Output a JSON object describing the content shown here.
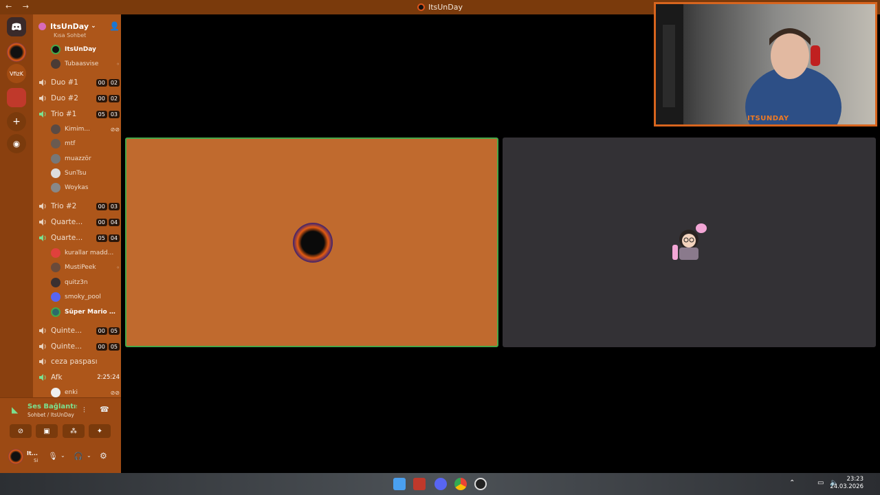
{
  "window": {
    "title": "ItsUnDay"
  },
  "servers": {
    "vfizk_label": "VfizK"
  },
  "guild": {
    "name": "ItsUnDay"
  },
  "category": {
    "label": "Kısa Sohbet"
  },
  "channels": [
    {
      "name": "Duo #1",
      "counts": [
        "00",
        "02"
      ]
    },
    {
      "name": "Duo #2",
      "counts": [
        "00",
        "02"
      ]
    },
    {
      "name": "Trio #1",
      "counts": [
        "05",
        "03"
      ]
    },
    {
      "name": "Trio #2",
      "counts": [
        "00",
        "03"
      ]
    },
    {
      "name": "Quarte...",
      "counts": [
        "00",
        "04"
      ]
    },
    {
      "name": "Quarte...",
      "counts": [
        "05",
        "04"
      ]
    },
    {
      "name": "Quinte...",
      "counts": [
        "00",
        "05"
      ]
    },
    {
      "name": "Quinte...",
      "counts": [
        "00",
        "05"
      ]
    },
    {
      "name": "ceza paspası"
    },
    {
      "name": "Afk",
      "timer": "2:25:24"
    }
  ],
  "users": {
    "top": [
      "ItsUnDay",
      "Tubaasvise"
    ],
    "trio1": [
      "Kimim...",
      "mtf",
      "muazzör",
      "SunTsu",
      "Woykas"
    ],
    "quarte2": [
      "kurallar madd...",
      "MustiPeek",
      "quitz3n",
      "smoky_pool",
      "Süper Mario N..."
    ],
    "afk": [
      "enki"
    ]
  },
  "voice": {
    "status": "Ses Bağlantısı Kuruldu",
    "location": "Sohbet / ItsUnDay"
  },
  "me": {
    "name": "It...",
    "sub": "Si"
  },
  "webcam": {
    "label": "ITSUNDAY"
  },
  "clock": {
    "time": "23:23",
    "date": "24.03.2026"
  },
  "colors": {
    "accent": "#d8651e",
    "sidebar": "#ad561a",
    "speaking": "#45a84a"
  }
}
